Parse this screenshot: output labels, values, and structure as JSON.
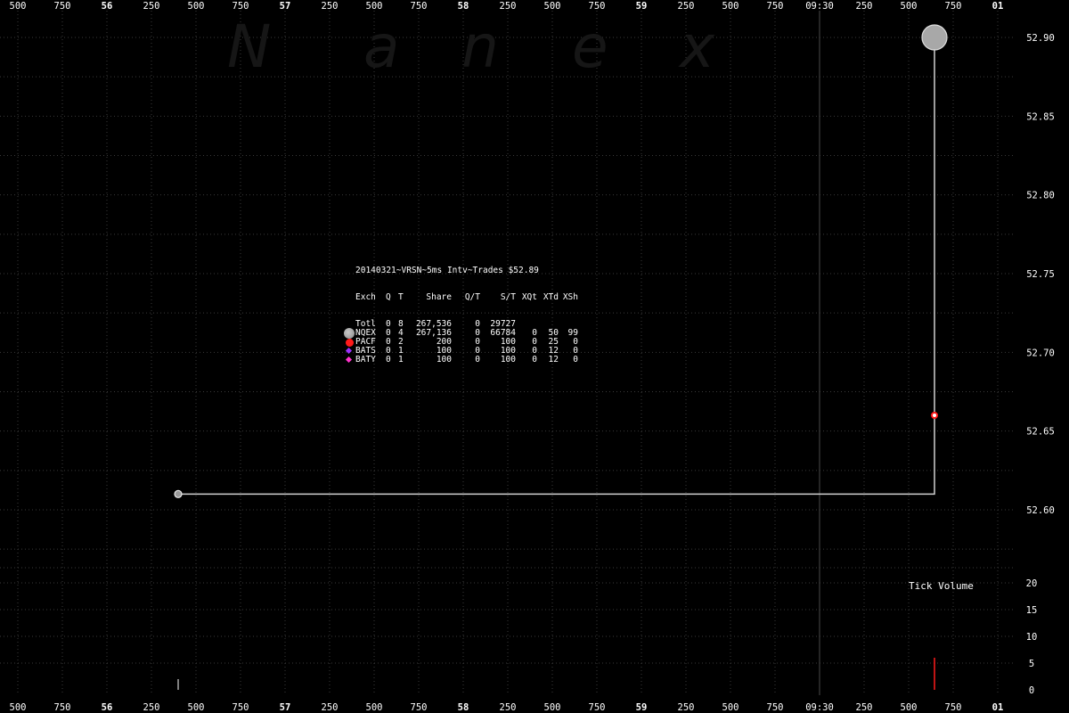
{
  "watermark": [
    "N",
    "a",
    "n",
    "e",
    "x"
  ],
  "legend": {
    "title": "20140321~VRSN~5ms Intv~Trades $52.89",
    "header": [
      "Exch",
      "Q",
      "T",
      "Share",
      "Q/T",
      "S/T",
      "XQt",
      "XTd",
      "XSh"
    ],
    "rows": [
      {
        "exch": "Totl",
        "q": "0",
        "t": "8",
        "share": "267,536",
        "qt": "0",
        "st": "29727",
        "xqt": "",
        "xtd": "",
        "xsh": "",
        "marker": "",
        "color": ""
      },
      {
        "exch": "NQEX",
        "q": "0",
        "t": "4",
        "share": "267,136",
        "qt": "0",
        "st": "66784",
        "xqt": "0",
        "xtd": "50",
        "xsh": "99",
        "marker": "circle-large",
        "color": "#a8a8a8"
      },
      {
        "exch": "PACF",
        "q": "0",
        "t": "2",
        "share": "200",
        "qt": "0",
        "st": "100",
        "xqt": "0",
        "xtd": "25",
        "xsh": "0",
        "marker": "circle",
        "color": "#ff1a1a"
      },
      {
        "exch": "BATS",
        "q": "0",
        "t": "1",
        "share": "100",
        "qt": "0",
        "st": "100",
        "xqt": "0",
        "xtd": "12",
        "xsh": "0",
        "marker": "diamond",
        "color": "#9b30ff"
      },
      {
        "exch": "BATY",
        "q": "0",
        "t": "1",
        "share": "100",
        "qt": "0",
        "st": "100",
        "xqt": "0",
        "xtd": "12",
        "xsh": "0",
        "marker": "diamond",
        "color": "#ff33cc"
      }
    ]
  },
  "volume_title": "Tick Volume",
  "chart_data": [
    {
      "type": "line",
      "title": "20140321~VRSN~5ms Intv~Trades $52.89",
      "x_ticks": [
        "500",
        "750",
        "56",
        "250",
        "500",
        "750",
        "57",
        "250",
        "500",
        "750",
        "58",
        "250",
        "500",
        "750",
        "59",
        "250",
        "500",
        "750",
        "09:30",
        "250",
        "500",
        "750",
        "01"
      ],
      "x_ticks_bold": [
        "56",
        "57",
        "58",
        "59",
        "01"
      ],
      "marker_x_tick": "09:30",
      "ylim": [
        52.55,
        52.92
      ],
      "y_ticks": [
        52.6,
        52.65,
        52.7,
        52.75,
        52.8,
        52.85,
        52.9
      ],
      "grid": true,
      "price_line_color": "#d0d0d0",
      "series": [
        {
          "name": "NQEX",
          "color": "#a8a8a8",
          "points": [
            {
              "x": 3.6,
              "y": 52.61,
              "marker": "small"
            },
            {
              "x": 20.58,
              "y": 52.61,
              "marker": ""
            },
            {
              "x": 20.58,
              "y": 52.66,
              "marker": ""
            },
            {
              "x": 20.58,
              "y": 52.9,
              "marker": "large"
            }
          ]
        },
        {
          "name": "PACF",
          "color": "#ff1a1a",
          "points": [
            {
              "x": 20.58,
              "y": 52.66,
              "marker": "ring"
            }
          ]
        }
      ]
    },
    {
      "type": "bar",
      "title": "Tick Volume",
      "ylim": [
        0,
        22
      ],
      "y_ticks": [
        0,
        5,
        10,
        15,
        20
      ],
      "bars": [
        {
          "x": 3.6,
          "value": 2,
          "color": "#a8a8a8"
        },
        {
          "x": 20.58,
          "value": 6,
          "color": "#ff1a1a"
        }
      ]
    }
  ]
}
